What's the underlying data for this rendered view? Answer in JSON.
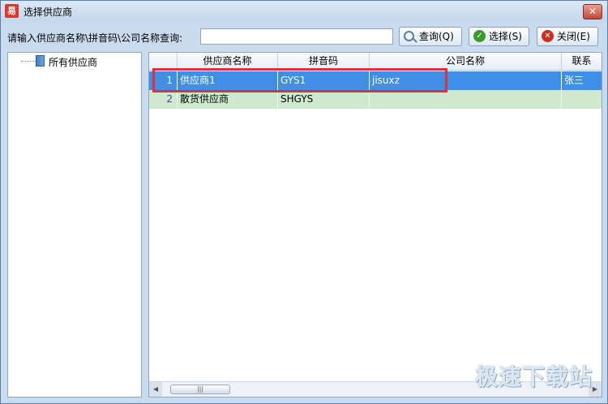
{
  "window": {
    "title": "选择供应商",
    "app_icon_text": "易",
    "close_glyph": "✕"
  },
  "toolbar": {
    "query_label": "请输入供应商名称\\拼音码\\公司名称查询:",
    "query_value": "",
    "search_label": "查询(Q)",
    "select_label": "选择(S)",
    "close_label": "关闭(E)"
  },
  "tree": {
    "root_label": "所有供应商"
  },
  "grid": {
    "columns": [
      "",
      "供应商名称",
      "拼音码",
      "公司名称",
      "联系"
    ],
    "rows": [
      {
        "num": "1",
        "name": "供应商1",
        "pinyin": "GYS1",
        "company": "jisuxz",
        "contact": "张三"
      },
      {
        "num": "2",
        "name": "散货供应商",
        "pinyin": "SHGYS",
        "company": "",
        "contact": ""
      }
    ]
  },
  "scrollbar": {
    "left_arrow": "◀",
    "right_arrow": "▶",
    "thumb_grip": "|||"
  },
  "watermark": "极速下载站",
  "colors": {
    "selected_row": "#3e8fe6",
    "alt_row": "#cfe9cf",
    "highlight_box": "#e0303a"
  }
}
